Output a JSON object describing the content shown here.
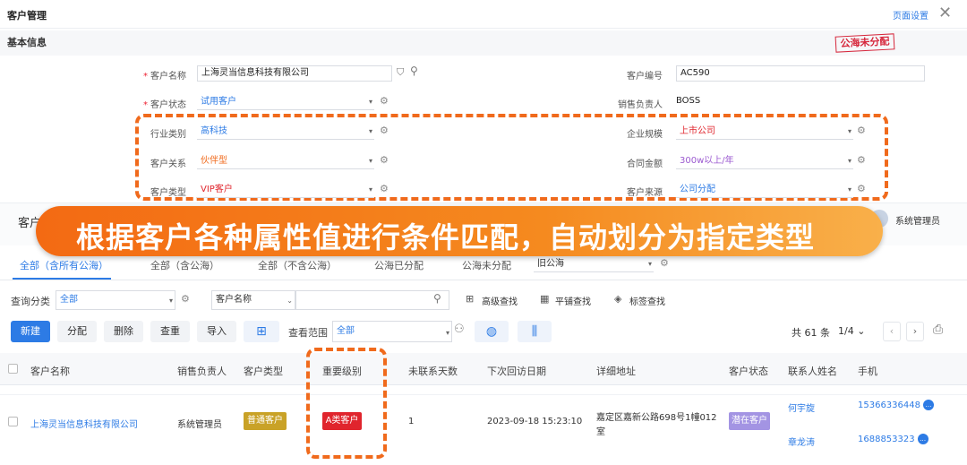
{
  "header": {
    "title": "客户管理",
    "page_settings": "页面设置",
    "close": "✕"
  },
  "basic_info": {
    "label": "基本信息",
    "stamp": "公海未分配"
  },
  "form": {
    "customer_name": {
      "label": "客户名称",
      "value": "上海灵当信息科技有限公司"
    },
    "customer_no": {
      "label": "客户编号",
      "value": "AC590"
    },
    "customer_status": {
      "label": "客户状态",
      "value": "试用客户"
    },
    "sales_owner": {
      "label": "销售负责人",
      "value": "BOSS"
    },
    "industry": {
      "label": "行业类别",
      "value": "高科技"
    },
    "company_size": {
      "label": "企业规模",
      "value": "上市公司"
    },
    "relation": {
      "label": "客户关系",
      "value": "伙伴型"
    },
    "contract_amount": {
      "label": "合同金额",
      "value": "300w以上/年"
    },
    "customer_type": {
      "label": "客户类型",
      "value": "VIP客户"
    },
    "source": {
      "label": "客户来源",
      "value": "公司分配"
    }
  },
  "colors": {
    "accent": "#2d7be5",
    "orange": "#f06a1c",
    "red": "#e0252d",
    "purple": "#9b59d0"
  },
  "behind_banner": {
    "left_text": "客户",
    "user": "系统管理员"
  },
  "banner": {
    "text": "根据客户各种属性值进行条件匹配，自动划分为指定类型"
  },
  "tabs": [
    "全部（含所有公海）",
    "全部（含公海）",
    "全部（不含公海）",
    "公海已分配",
    "公海未分配"
  ],
  "old_pool": {
    "value": "旧公海"
  },
  "query": {
    "category_label": "查询分类",
    "category_value": "全部",
    "field_select": "客户名称",
    "advanced": "高级查找",
    "flat": "平铺查找",
    "tag": "标签查找"
  },
  "toolbar": {
    "new": "新建",
    "assign": "分配",
    "delete": "删除",
    "dedupe": "查重",
    "import": "导入",
    "scope_label": "查看范围",
    "scope_value": "全部",
    "total": "共 61 条",
    "page": "1/4"
  },
  "table": {
    "headers": [
      "客户名称",
      "销售负责人",
      "客户类型",
      "重要级别",
      "未联系天数",
      "下次回访日期",
      "详细地址",
      "客户状态",
      "联系人姓名",
      "手机"
    ],
    "row": {
      "name": "上海灵当信息科技有限公司",
      "owner": "系统管理员",
      "type": "普通客户",
      "level": "A类客户",
      "days": "1",
      "next_visit": "2023-09-18 15:23:10",
      "address_line1": "嘉定区嘉新公路698号1幢012",
      "address_line2": "室",
      "status": "潜在客户",
      "contact1": "何宇旋",
      "contact2": "章龙涛",
      "phone1": "15366336448",
      "phone2": "1688853323"
    }
  }
}
